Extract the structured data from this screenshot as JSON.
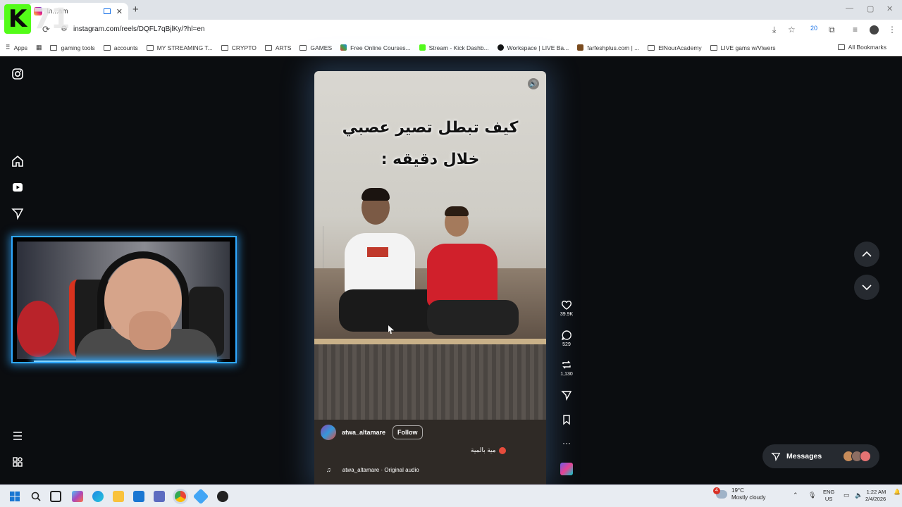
{
  "browser": {
    "tab_title": "In...am",
    "url": "instagram.com/reels/DQFL7qBjlKy/?hl=en",
    "bookmarks": [
      {
        "label": "Apps",
        "icon": "apps-grid-icon"
      },
      {
        "label": "gaming tools",
        "icon": "folder-icon"
      },
      {
        "label": "accounts",
        "icon": "folder-icon"
      },
      {
        "label": "MY STREAMING T...",
        "icon": "folder-icon"
      },
      {
        "label": "CRYPTO",
        "icon": "folder-icon"
      },
      {
        "label": "ARTS",
        "icon": "folder-icon"
      },
      {
        "label": "GAMES",
        "icon": "folder-icon"
      },
      {
        "label": "Free Online Courses...",
        "icon": "triangle-logo-icon"
      },
      {
        "label": "Stream - Kick Dashb...",
        "icon": "kick-logo-icon"
      },
      {
        "label": "Workspace | LIVE Ba...",
        "icon": "tiktok-logo-icon"
      },
      {
        "label": "farfeshplus.com | ...",
        "icon": "site-logo-icon"
      },
      {
        "label": "ElNourAcademy",
        "icon": "folder-icon"
      },
      {
        "label": "LIVE gams w/Viwers",
        "icon": "folder-icon"
      }
    ],
    "all_bookmarks": "All Bookmarks",
    "extension_badge": "20"
  },
  "overlay": {
    "logo_letter": "K",
    "logo_number": "71"
  },
  "reel": {
    "caption_line1": "كيف تبطل تصير عصبي",
    "caption_line2": "خلال دقيقه :",
    "author": "atwa_altamare",
    "follow_label": "Follow",
    "description": "مية بالمية",
    "audio": "atwa_altamare · Original audio",
    "likes": "39.9K",
    "comments": "529",
    "reposts": "1,130"
  },
  "messages": {
    "label": "Messages"
  },
  "taskbar": {
    "weather_temp": "19°C",
    "weather_desc": "Mostly cloudy",
    "weather_badge": "4",
    "lang_line1": "ENG",
    "lang_line2": "US",
    "time": "1:22 AM",
    "date": "2/4/2026"
  },
  "colors": {
    "page_bg": "#0b0d10",
    "webcam_border": "#2fa8ff",
    "kick_green": "#53fc18"
  }
}
